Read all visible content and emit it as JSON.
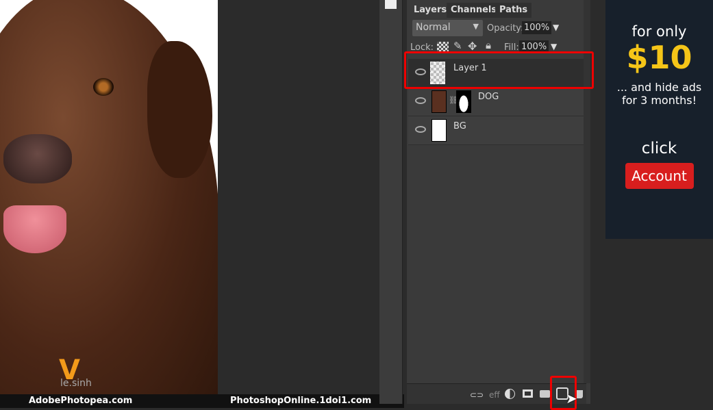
{
  "footer": {
    "left": "AdobePhotopea.com",
    "right": "PhotoshopOnline.1doi1.com"
  },
  "watermark": "le.sinh",
  "panel": {
    "tabs": [
      {
        "label": "Layers"
      },
      {
        "label": "Channels"
      },
      {
        "label": "Paths"
      }
    ],
    "blend_mode": "Normal",
    "opacity_label": "Opacity:",
    "opacity": "100%",
    "lock_label": "Lock:",
    "fill_label": "Fill:",
    "fill": "100%",
    "layers": [
      {
        "name": "Layer 1",
        "selected": true
      },
      {
        "name": "DOG"
      },
      {
        "name": "BG"
      }
    ],
    "bottom_icons": [
      "link-icon",
      "effects-icon",
      "adjustment-icon",
      "mask-icon",
      "folder-icon",
      "new-layer-icon",
      "trash-icon"
    ],
    "effects_label": "eff"
  },
  "ad": {
    "line1": "for only",
    "price": "$10",
    "line2": "... and hide ads",
    "line3": "for 3 months!",
    "click": "click",
    "button": "Account"
  },
  "colors": {
    "highlight": "#e00000",
    "price": "#f5c518",
    "ad_button": "#d81e1e"
  }
}
